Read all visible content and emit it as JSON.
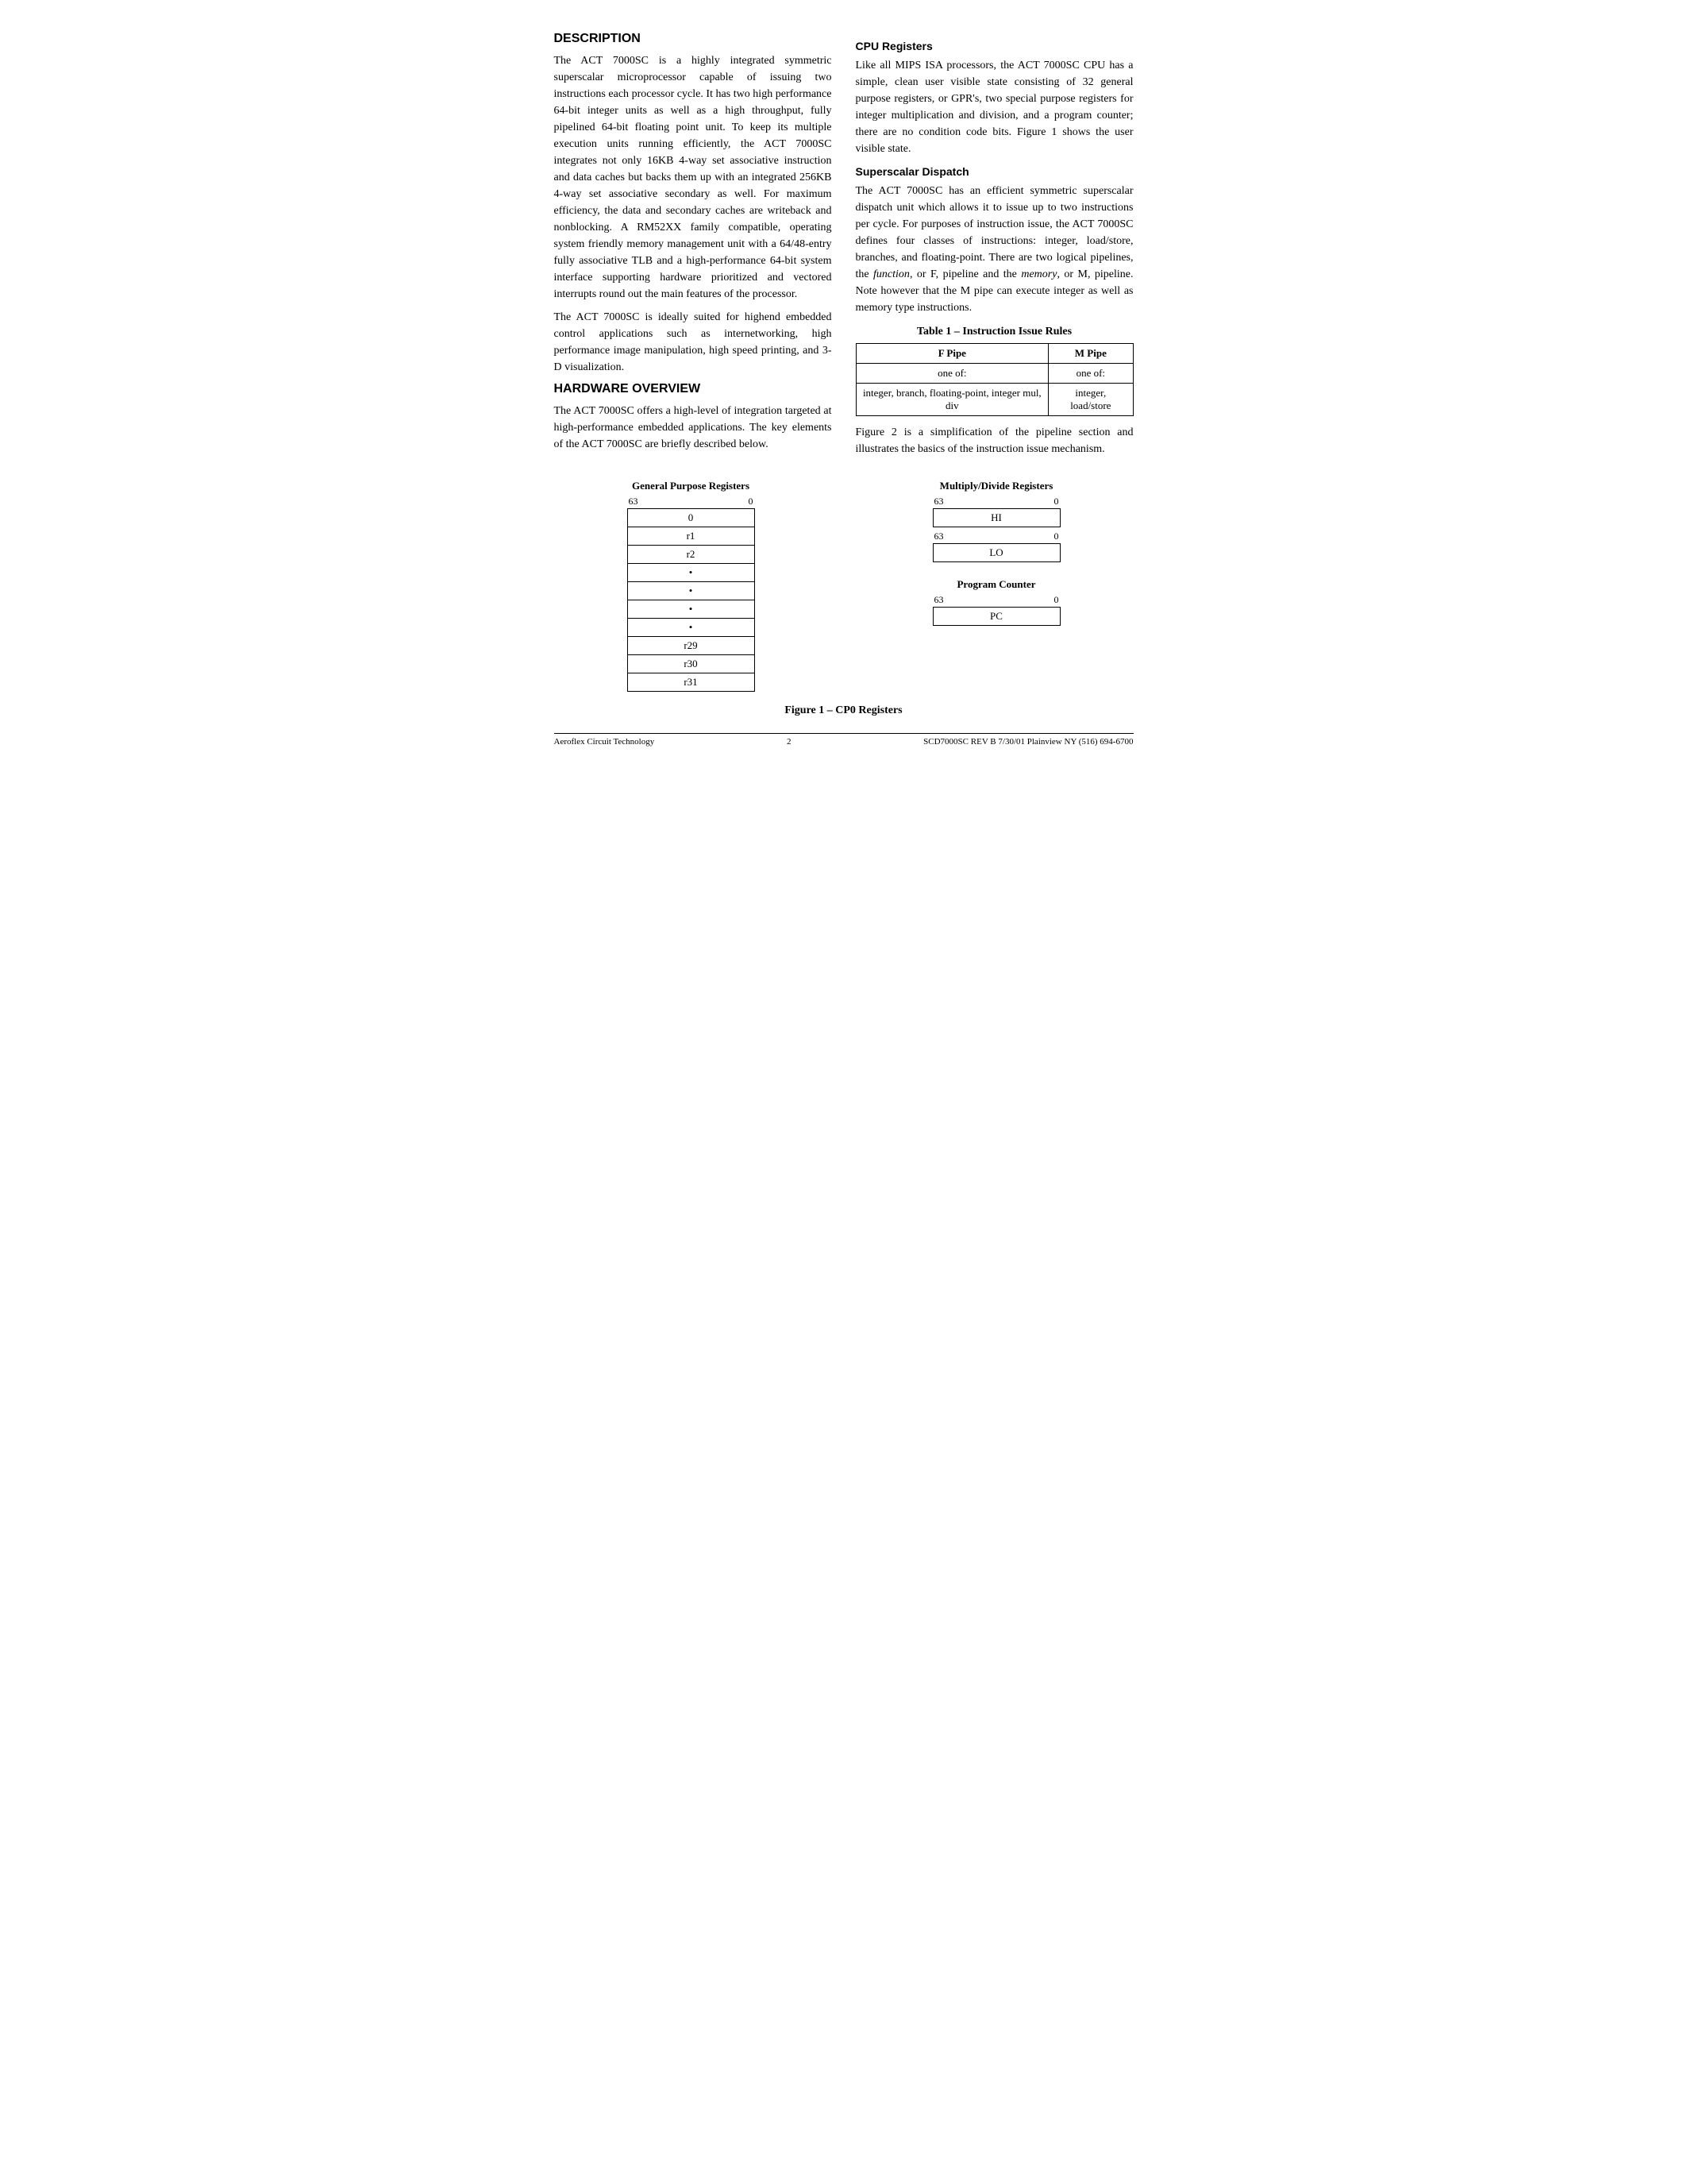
{
  "page": {
    "footer": {
      "left": "Aeroflex Circuit Technology",
      "center": "2",
      "right": "SCD7000SC REV B  7/30/01  Plainview NY (516) 694-6700"
    }
  },
  "description": {
    "title": "DESCRIPTION",
    "paragraphs": [
      "The ACT 7000SC is a highly integrated symmetric superscalar microprocessor capable of issuing two instructions each processor cycle. It has two high performance 64-bit integer units as well as a high throughput, fully pipelined 64-bit floating point unit. To keep its multiple execution units running efficiently, the ACT 7000SC integrates not only 16KB 4-way set associative instruction and data caches but backs them up with an integrated 256KB 4-way set associative secondary as well. For maximum efficiency, the data and secondary caches are writeback and nonblocking. A RM52XX family compatible, operating system friendly memory management unit with a 64/48-entry fully associative TLB and a high-performance 64-bit system interface supporting hardware prioritized and vectored interrupts round out the main features of the processor.",
      "The ACT 7000SC is ideally suited for highend embedded control applications such as internetworking, high performance image manipulation, high speed printing, and 3-D visualization."
    ]
  },
  "hardware_overview": {
    "title": "HARDWARE OVERVIEW",
    "paragraph": "The ACT 7000SC offers a high-level of integration targeted at high-performance embedded applications. The key elements of the ACT 7000SC are briefly described below."
  },
  "cpu_registers": {
    "title": "CPU Registers",
    "paragraph": "Like all MIPS ISA processors, the ACT 7000SC CPU has a simple, clean user visible state consisting of 32 general purpose registers, or GPR's, two special purpose registers for integer multiplication and division, and a program counter; there are no condition code bits. Figure 1 shows the user visible state."
  },
  "superscalar_dispatch": {
    "title": "Superscalar Dispatch",
    "paragraph": "The ACT 7000SC has an efficient symmetric superscalar dispatch unit which allows it to issue up to two instructions per cycle. For purposes of instruction issue, the ACT 7000SC defines four classes of instructions: integer, load/store, branches, and floating-point. There are two logical pipelines, the function, or F, pipeline and the memory, or M, pipeline. Note however that the M pipe can execute integer as well as memory type instructions."
  },
  "table": {
    "title": "Table 1 – Instruction Issue Rules",
    "headers": [
      "F Pipe",
      "M Pipe"
    ],
    "row1": [
      "one of:",
      "one of:"
    ],
    "row2": [
      "integer, branch, floating-point, integer mul, div",
      "integer, load/store"
    ]
  },
  "table_caption": "Figure 2 is a simplification of the pipeline section and illustrates the basics of the instruction issue mechanism.",
  "gpr_diagram": {
    "title": "General Purpose Registers",
    "high": "63",
    "low": "0",
    "rows": [
      "0",
      "r1",
      "r2",
      "•",
      "•",
      "•",
      "•",
      "r29",
      "r30",
      "r31"
    ]
  },
  "multiply_divide_diagram": {
    "title": "Multiply/Divide Registers",
    "high": "63",
    "low": "0",
    "rows_hi": [
      "HI"
    ],
    "high2": "63",
    "low2": "0",
    "rows_lo": [
      "LO"
    ]
  },
  "program_counter_diagram": {
    "title": "Program Counter",
    "high": "63",
    "low": "0",
    "rows": [
      "PC"
    ]
  },
  "figure_caption": "Figure 1 – CP0 Registers"
}
